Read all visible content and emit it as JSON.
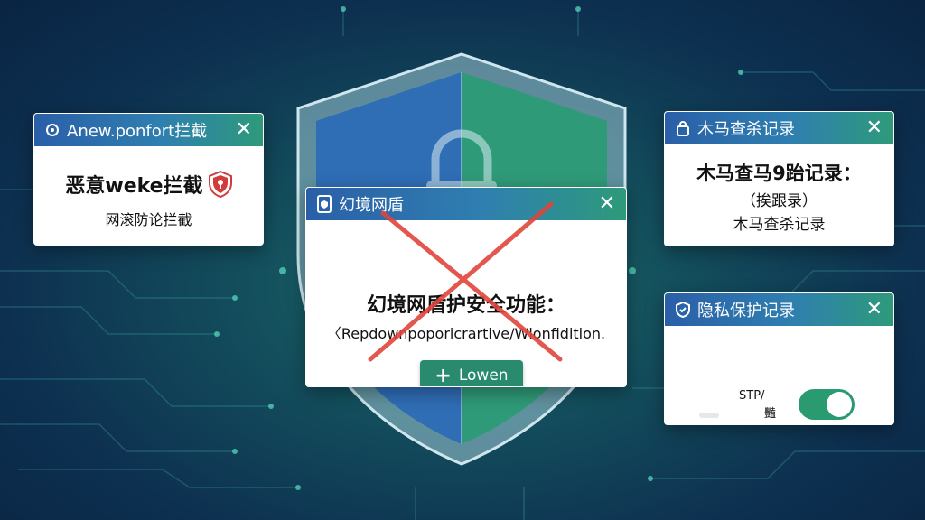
{
  "colors": {
    "accent_blue": "#2a5fa8",
    "accent_green": "#2e9a7a",
    "cross_red": "#e0453c",
    "toggle_on": "#2a9a70"
  },
  "left_card": {
    "title": "Anew.ponfort拦截",
    "header_icon": "settings-gear-icon",
    "headline": "恶意weke拦截",
    "headline_icon": "shield-keyhole-icon",
    "sub": "网滚防论拦截"
  },
  "center_card": {
    "title": "幻境网盾",
    "header_icon": "document-shield-icon",
    "headline": "幻境网盾护安全功能：",
    "sub": "〈Repdownpoporicrartive/Wlonfidition.",
    "button_label": "Lowen",
    "button_icon": "plus-icon",
    "overlay": "red-x-cross"
  },
  "top_right_card": {
    "title": "木马查杀记录",
    "header_icon": "lock-icon",
    "line1": "木马查马9跆记录：",
    "line2": "（挨跟录）",
    "line3": "木马查杀记录"
  },
  "bottom_right_card": {
    "title": "隐私保护记录",
    "header_icon": "shield-check-icon",
    "label_a": "STP/",
    "label_b": "豔",
    "toggle_state": "on"
  }
}
